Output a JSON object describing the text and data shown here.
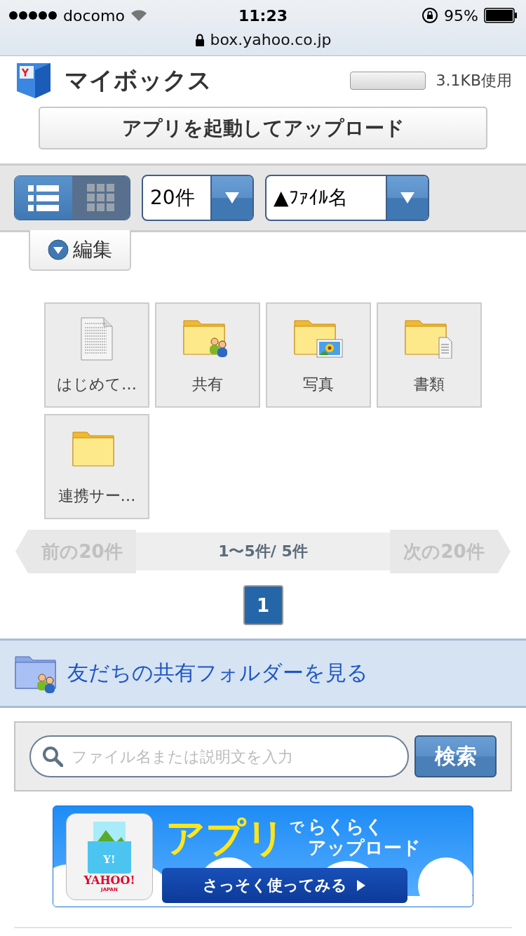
{
  "status_bar": {
    "carrier": "docomo",
    "time": "11:23",
    "battery": "95%"
  },
  "url_bar": {
    "url": "box.yahoo.co.jp"
  },
  "header": {
    "title": "マイボックス",
    "usage": {
      "level": 0,
      "reading": "3.1KB使用"
    }
  },
  "upload_button": "アプリを起動してアップロード",
  "toolbar": {
    "views": [
      {
        "kind": "list",
        "selected": false
      },
      {
        "kind": "grid",
        "selected": true
      }
    ],
    "per_page": {
      "value": "20件"
    },
    "sort": {
      "value": "▲ﾌｧｲﾙ名"
    }
  },
  "edit_tab": "編集",
  "files": [
    {
      "name": "はじめて…",
      "kind": "document"
    },
    {
      "name": "共有",
      "kind": "shared-folder"
    },
    {
      "name": "写真",
      "kind": "photo-folder"
    },
    {
      "name": "書類",
      "kind": "document-folder"
    },
    {
      "name": "連携サー…",
      "kind": "folder"
    }
  ],
  "pagination": {
    "prev": {
      "label": "前の20件",
      "disabled": true
    },
    "range": "1〜5件/ 5件",
    "next": {
      "label": "次の20件",
      "disabled": true
    },
    "pages": [
      {
        "label": "1",
        "selected": true
      }
    ]
  },
  "friends_link": "友だちの共有フォルダーを見る",
  "search": {
    "placeholder": "ファイル名または説明文を入力",
    "button": "検索"
  },
  "banner": {
    "headline": "アプリ",
    "particle": "で",
    "line_1": "らくらく",
    "line_2": "アップロード",
    "cta": "さっそく使ってみる",
    "app_mark": "Y!",
    "logo": "YAHOO!",
    "logo_sub": "JAPAN"
  }
}
